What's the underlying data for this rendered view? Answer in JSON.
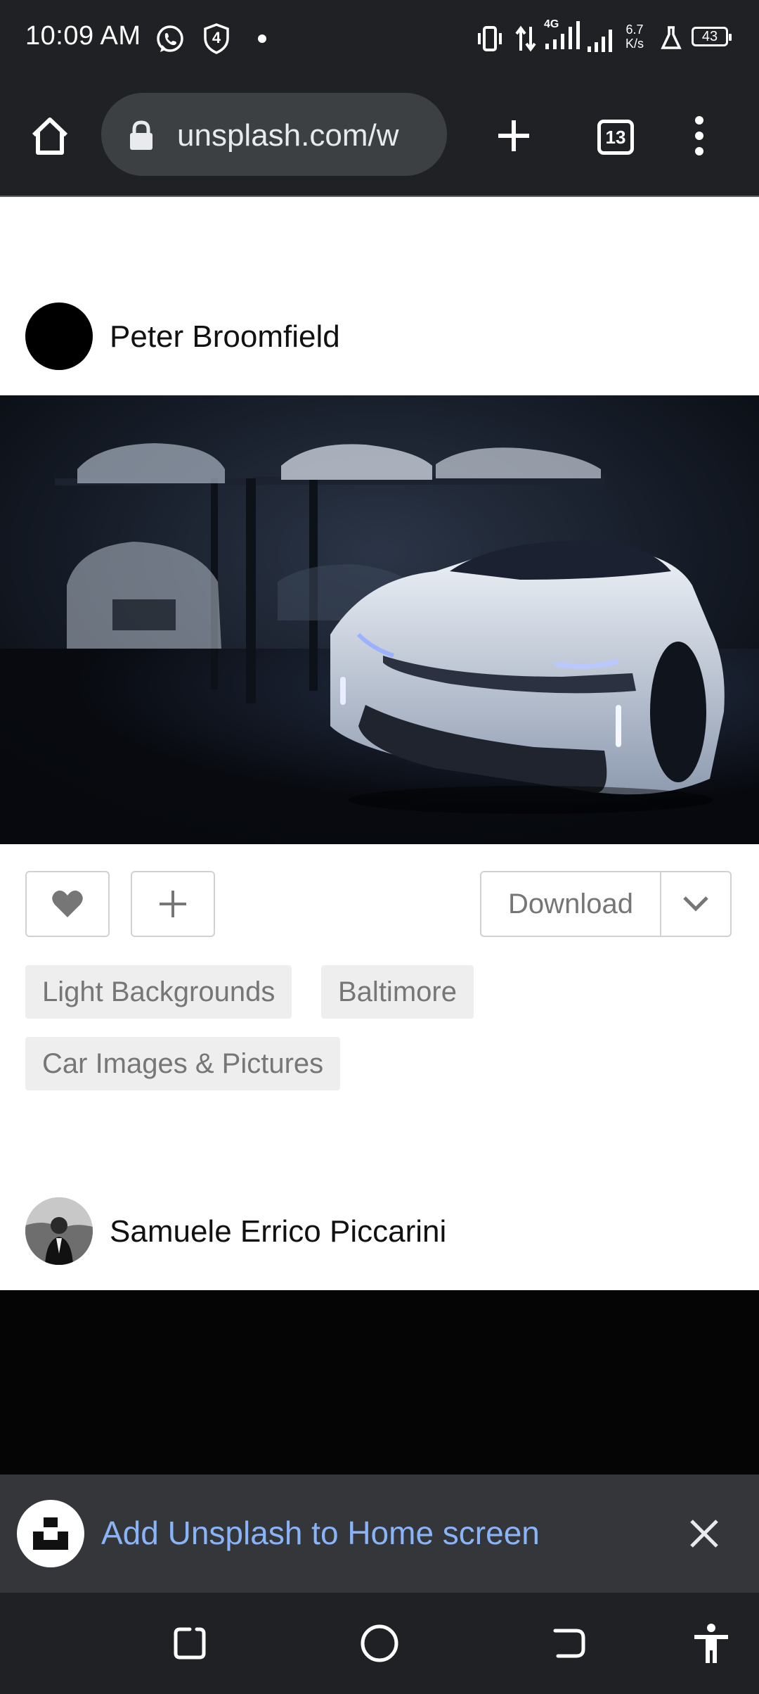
{
  "status_bar": {
    "time": "10:09 AM",
    "notification_count": "4",
    "network_type": "4G",
    "net_speed_value": "6.7",
    "net_speed_unit": "K/s",
    "battery": "43",
    "icons": [
      "whatsapp-icon",
      "shield-badge-icon",
      "dot-icon",
      "vibrate-icon",
      "data-arrows-icon",
      "signal-icon",
      "signal-icon-2",
      "lab-flask-icon",
      "battery-icon"
    ]
  },
  "browser": {
    "url": "unsplash.com/w",
    "tab_count": "13",
    "icons": [
      "home-icon",
      "lock-icon",
      "new-tab-icon",
      "tab-switcher-icon",
      "more-vert-icon"
    ]
  },
  "posts": [
    {
      "author": "Peter Broomfield",
      "photo_alt": "White sports car in a dark garage",
      "actions": {
        "download_label": "Download"
      },
      "tags": [
        "Light Backgrounds",
        "Baltimore",
        "Car Images & Pictures"
      ]
    },
    {
      "author": "Samuele Errico Piccarini"
    }
  ],
  "install_banner": {
    "text": "Add Unsplash to Home screen"
  },
  "colors": {
    "chrome_dark": "#202124",
    "url_bar": "#3c4043",
    "banner_bg": "#35363a",
    "banner_link": "#8ab4f8",
    "tag_bg": "#eeeeee",
    "muted_text": "#767676"
  }
}
